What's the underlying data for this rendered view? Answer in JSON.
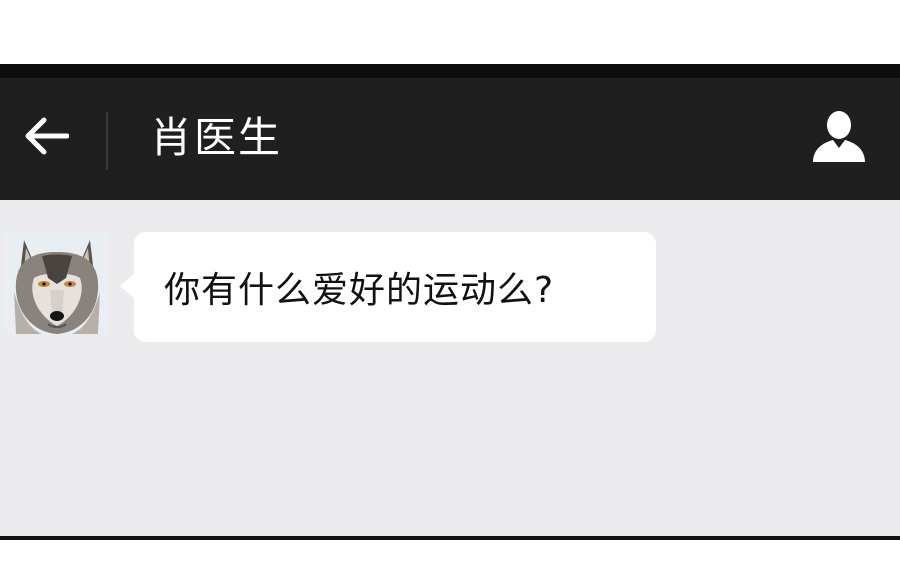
{
  "header": {
    "title": "肖医生",
    "back_icon": "back-arrow-icon",
    "profile_icon": "person-icon",
    "background": "#1f1f1f"
  },
  "chat": {
    "background": "#ebebed",
    "messages": [
      {
        "sender": "other",
        "avatar": "wolf-avatar",
        "text": "你有什么爱好的运动么?"
      }
    ]
  }
}
